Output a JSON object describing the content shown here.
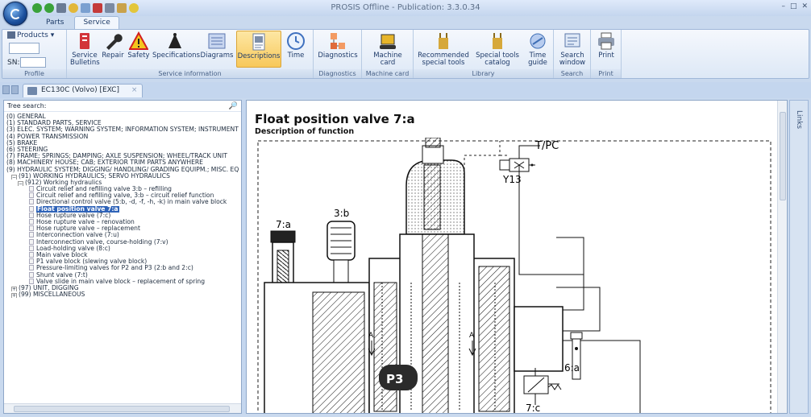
{
  "window": {
    "title": "PROSIS Offline - Publication: 3.3.0.34",
    "controls": [
      "–",
      "□",
      "✕"
    ]
  },
  "ribbon_tabs": [
    {
      "label": "Parts",
      "active": false
    },
    {
      "label": "Service",
      "active": true
    }
  ],
  "profile_group": {
    "products_label": "Products",
    "sn_label": "SN:",
    "group_label": "Profile"
  },
  "service_info_group": {
    "label": "Service information",
    "buttons": [
      {
        "label": "Service\nBulletins",
        "icon": "bulletin-icon"
      },
      {
        "label": "Repair",
        "icon": "wrench-icon"
      },
      {
        "label": "Safety",
        "icon": "warning-icon"
      },
      {
        "label": "Specifications",
        "icon": "spec-icon"
      },
      {
        "label": "Diagrams",
        "icon": "diagram-icon"
      },
      {
        "label": "Descriptions",
        "icon": "descriptions-icon",
        "active": true
      },
      {
        "label": "Time",
        "icon": "clock-icon"
      }
    ]
  },
  "diagnostics_group": {
    "label": "Diagnostics",
    "button": "Diagnostics"
  },
  "machine_card_group": {
    "label": "Machine card",
    "button": "Machine\ncard"
  },
  "library_group": {
    "label": "Library",
    "buttons": [
      {
        "label": "Recommended\nspecial tools"
      },
      {
        "label": "Special tools\ncatalog"
      },
      {
        "label": "Time\nguide"
      }
    ]
  },
  "search_group": {
    "label": "Search",
    "button": "Search\nwindow"
  },
  "print_group": {
    "label": "Print",
    "button": "Print"
  },
  "doc_tab": {
    "label": "EC130C (Volvo) [EXC]",
    "close": "×"
  },
  "tree": {
    "header": "Tree search:",
    "nodes": [
      {
        "text": "(0) GENERAL",
        "level": 0
      },
      {
        "text": "(1) STANDARD PARTS, SERVICE",
        "level": 0
      },
      {
        "text": "(3) ELEC. SYSTEM; WARNING SYSTEM; INFORMATION  SYSTEM; INSTRUMENT",
        "level": 0
      },
      {
        "text": "(4) POWER TRANSMISSION",
        "level": 0
      },
      {
        "text": "(5) BRAKE",
        "level": 0
      },
      {
        "text": "(6) STEERING",
        "level": 0
      },
      {
        "text": "(7) FRAME; SPRINGS; DAMPING; AXLE SUSPENSION;  WHEEL/TRACK UNIT",
        "level": 0
      },
      {
        "text": "(8) MACHINERY HOUSE; CAB; EXTERIOR TRIM PARTS  ANYWHERE",
        "level": 0
      },
      {
        "text": "(9) HYDRAULIC SYSTEM; DIGGING/ HANDLING/  GRADING EQUIPM.; MISC. EQ",
        "level": 0
      },
      {
        "text": "(91) WORKING HYDRAULICS; SERVO  HYDRAULICS",
        "level": 1,
        "box": "−"
      },
      {
        "text": "(912) Working hydraulics",
        "level": 2,
        "box": "−"
      },
      {
        "text": "Circuit relief and refilling valve 3:b – refilling",
        "level": 3
      },
      {
        "text": "Circuit relief and refilling valve, 3:b – circuit relief function",
        "level": 3
      },
      {
        "text": "Directional control valve (5:b, -d, -f, -h, -k) in main valve block",
        "level": 3
      },
      {
        "text": "Float position valve 7:a",
        "level": 3,
        "selected": true
      },
      {
        "text": "Hose rupture valve (7:c)",
        "level": 3
      },
      {
        "text": "Hose rupture valve – renovation",
        "level": 3
      },
      {
        "text": "Hose rupture valve – replacement",
        "level": 3
      },
      {
        "text": "Interconnection valve (7:u)",
        "level": 3
      },
      {
        "text": "Interconnection valve, course-holding (7:v)",
        "level": 3
      },
      {
        "text": "Load-holding valve (8:c)",
        "level": 3
      },
      {
        "text": "Main valve block",
        "level": 3
      },
      {
        "text": "P1 valve block (slewing valve block)",
        "level": 3
      },
      {
        "text": "Pressure-limiting valves for P2 and P3 (2:b and 2:c)",
        "level": 3
      },
      {
        "text": "Shunt valve (7:t)",
        "level": 3
      },
      {
        "text": "Valve slide in main valve block – replacement of spring",
        "level": 3
      },
      {
        "text": "(97) UNIT, DIGGING",
        "level": 1,
        "box": "+"
      },
      {
        "text": "(99) MISCELLANEOUS",
        "level": 1,
        "box": "+"
      }
    ]
  },
  "document": {
    "title": "Float position valve 7:a",
    "subtitle": "Description of function",
    "diagram_labels": {
      "tpc": "T/PC",
      "y13": "Y13",
      "v3b": "3:b",
      "v7a": "7:a",
      "p3": "P3",
      "a_left": "A",
      "a_right": "A",
      "v6a": "6:a",
      "v7c": "7:c"
    }
  },
  "links_panel": {
    "label": "Links"
  }
}
